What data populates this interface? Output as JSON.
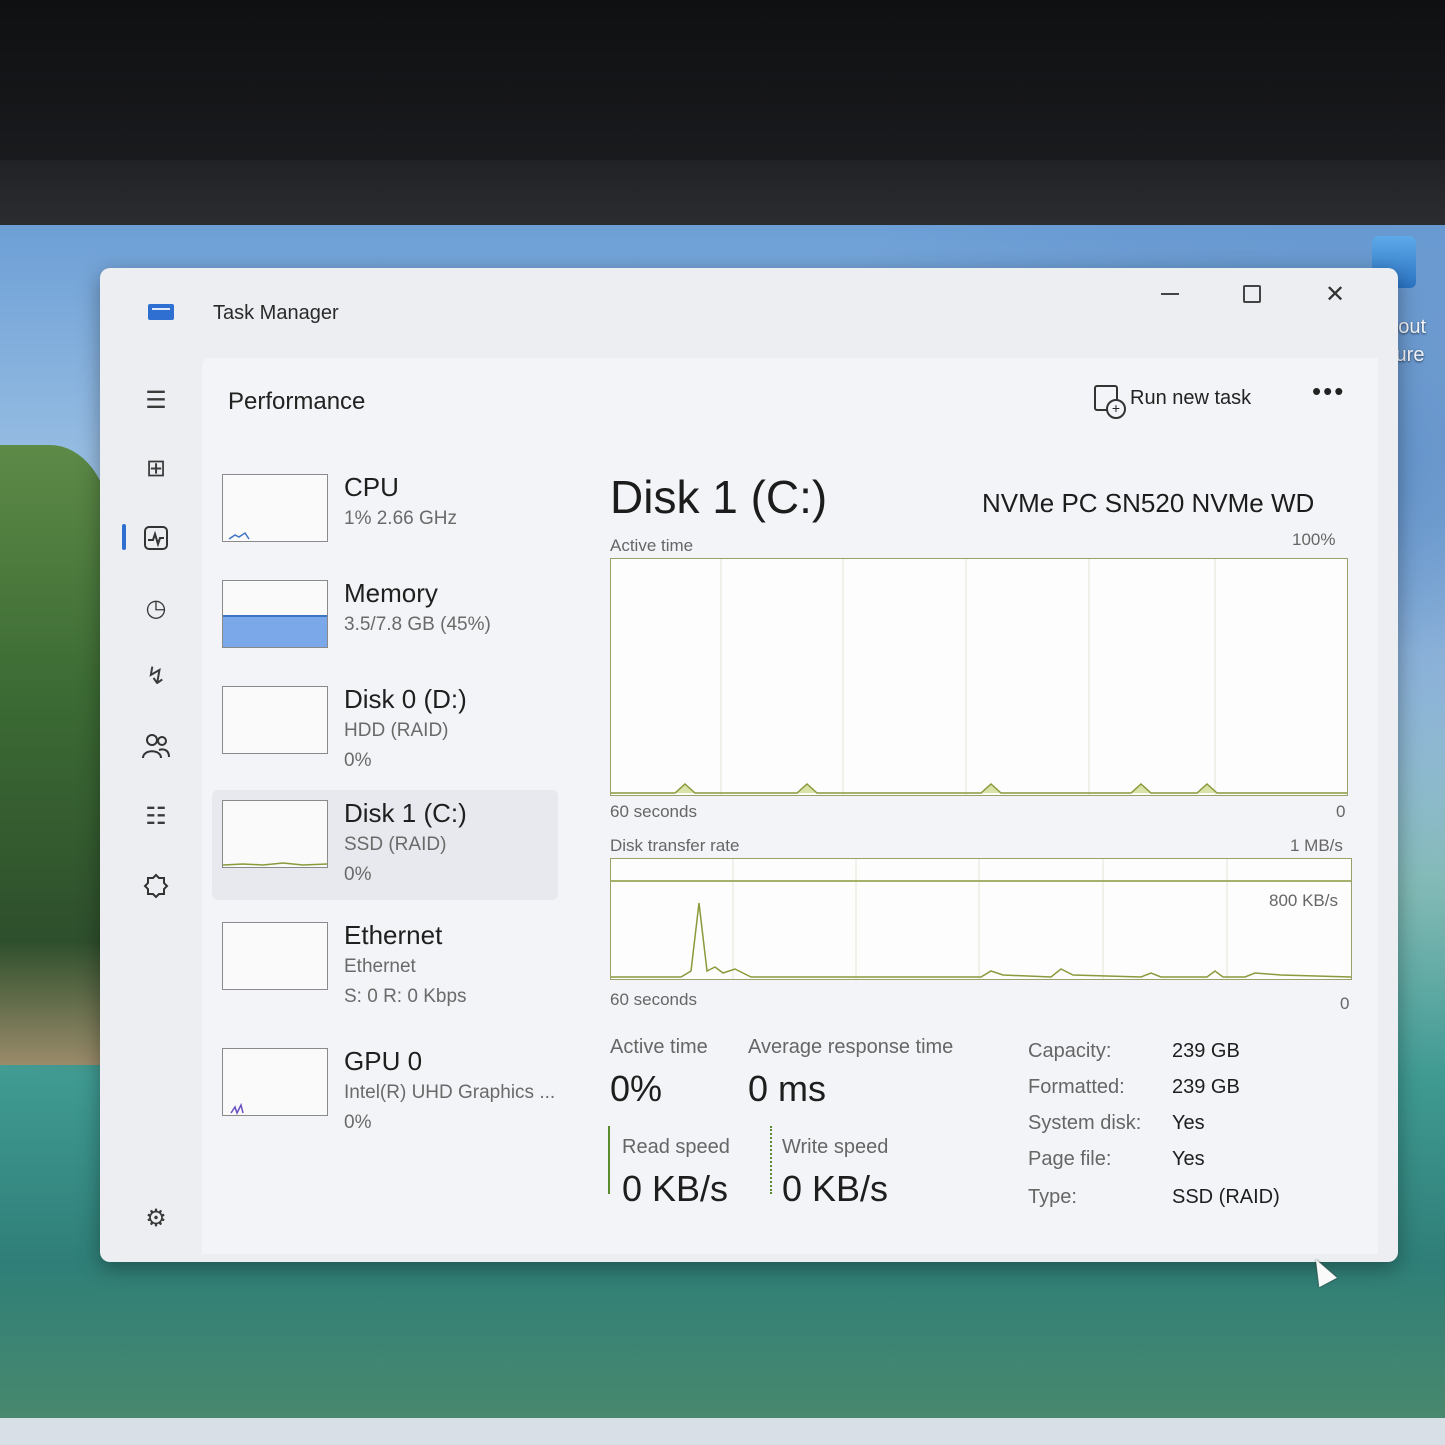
{
  "window": {
    "title": "Task Manager"
  },
  "header": {
    "page_title": "Performance",
    "run_new_task": "Run new task",
    "more": "•••"
  },
  "desktop": {
    "label_line1": "about",
    "label_line2": "cture"
  },
  "resources": [
    {
      "name": "CPU",
      "sub": "1%  2.66 GHz",
      "sub2": ""
    },
    {
      "name": "Memory",
      "sub": "3.5/7.8 GB (45%)",
      "sub2": "",
      "fill_percent": 45
    },
    {
      "name": "Disk 0 (D:)",
      "sub": "HDD (RAID)",
      "sub2": "0%"
    },
    {
      "name": "Disk 1 (C:)",
      "sub": "SSD (RAID)",
      "sub2": "0%"
    },
    {
      "name": "Ethernet",
      "sub": "Ethernet",
      "sub2": "S: 0  R: 0 Kbps"
    },
    {
      "name": "GPU 0",
      "sub": "Intel(R) UHD Graphics ...",
      "sub2": "0%"
    }
  ],
  "detail": {
    "title": "Disk 1 (C:)",
    "model": "NVMe PC SN520 NVMe WD",
    "active_graph": {
      "label": "Active time",
      "max": "100%",
      "time": "60 seconds",
      "min": "0"
    },
    "transfer_graph": {
      "label": "Disk transfer rate",
      "max": "1 MB/s",
      "mid": "800 KB/s",
      "time": "60 seconds",
      "min": "0"
    },
    "stats": {
      "active_time_label": "Active time",
      "active_time_value": "0%",
      "avg_response_label": "Average response time",
      "avg_response_value": "0 ms",
      "read_label": "Read speed",
      "read_value": "0 KB/s",
      "write_label": "Write speed",
      "write_value": "0 KB/s"
    },
    "properties": [
      {
        "key": "Capacity:",
        "value": "239 GB"
      },
      {
        "key": "Formatted:",
        "value": "239 GB"
      },
      {
        "key": "System disk:",
        "value": "Yes"
      },
      {
        "key": "Page file:",
        "value": "Yes"
      },
      {
        "key": "Type:",
        "value": "SSD (RAID)"
      }
    ]
  },
  "colors": {
    "accent": "#2f6fd0",
    "graph_line": "#8a9a3a",
    "memory_fill": "#7aa8e8"
  }
}
